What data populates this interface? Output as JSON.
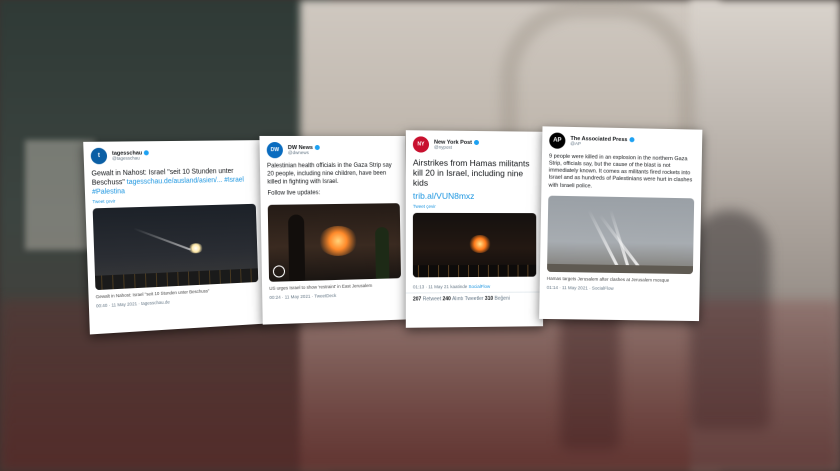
{
  "tweets": [
    {
      "name": "tagesschau",
      "handle": "@tagesschau",
      "text": "Gewalt in Nahost: Israel \"seit 10 Stunden unter Beschuss\"",
      "link": "tagesschau.de/ausland/asien/... #Israel #Palestina",
      "translate": "Tweet çevir",
      "caption": "Gewalt in Nahost: Israel \"seit 10 Stunden unter Beschuss\"",
      "meta": "00:40 · 11 May 2021 · tagesschau.de",
      "avatar_letter": "t"
    },
    {
      "name": "DW News",
      "handle": "@dwnews",
      "text": "Palestinian health officials in the Gaza Strip say 20 people, including nine children, have been killed in fighting with Israel.",
      "follow": "Follow live updates:",
      "caption": "US urges Israel to show 'restraint' in East Jerusalem",
      "meta": "00:24 · 11 May 2021 · TweetDeck",
      "avatar_letter": "DW"
    },
    {
      "name": "New York Post",
      "handle": "@nypost",
      "text": "Airstrikes from Hamas militants kill 20 in Israel, including nine kids",
      "link": "trib.al/VUN8mxz",
      "translate": "Tweet çevir",
      "meta_time": "01:13 · 11 May 21 kaatinde",
      "source": "SocialFlow",
      "retweets": "207",
      "retweets_label": "Retweet",
      "quotes": "240",
      "quotes_label": "Alıntı Tweetler",
      "likes": "310",
      "likes_label": "Beğeni",
      "avatar_letter": "NY"
    },
    {
      "name": "The Associated Press",
      "handle": "@AP",
      "text": "9 people were killed in an explosion in the northern Gaza Strip, officials say, but the cause of the blast is not immediately known. It comes as militants fired rockets into Israel and as hundreds of Palestinians were hurt in clashes with Israeli police.",
      "caption": "Hamas targets Jerusalem after clashes at Jerusalem mosque",
      "meta": "01:14 · 11 May 2021 · SocialFlow",
      "avatar_letter": "AP"
    }
  ],
  "colors": {
    "tagesschau": "#0b5fa5",
    "dw": "#0a6cbf",
    "nypost": "#c8102e",
    "ap": "#000000",
    "link": "#1b95e0"
  }
}
